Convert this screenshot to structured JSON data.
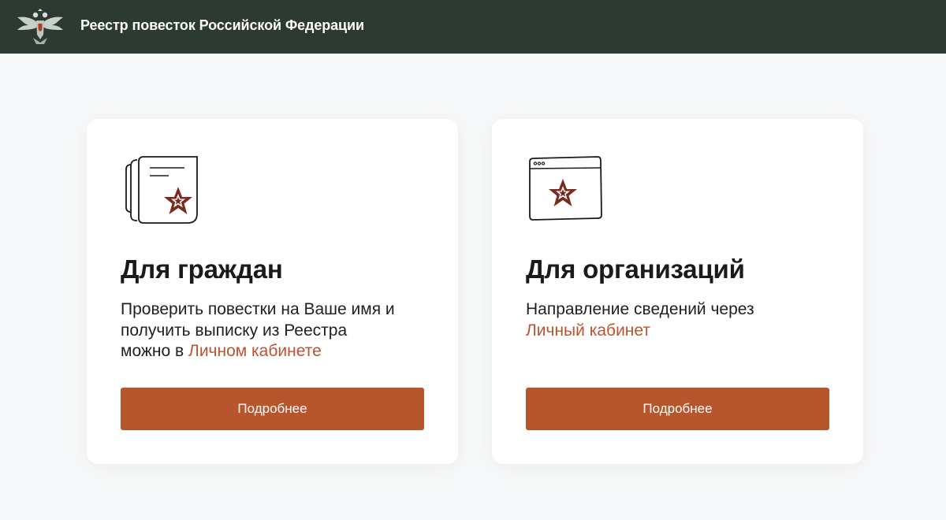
{
  "header": {
    "title": "Реестр повесток Российской Федерации",
    "emblem_icon": "double-headed-eagle-emblem"
  },
  "cards": [
    {
      "icon": "summons-document-star-icon",
      "title": "Для граждан",
      "desc_line1": "Проверить повестки на Ваше имя и",
      "desc_line2": "получить выписку из Реестра",
      "desc_line3_prefix": "можно в ",
      "desc_link": "Личном кабинете",
      "button_label": "Подробнее"
    },
    {
      "icon": "browser-window-star-icon",
      "title": "Для организаций",
      "desc_line1": "Направление сведений через",
      "desc_link": "Личный кабинет",
      "button_label": "Подробнее"
    }
  ],
  "colors": {
    "header_bg": "#2c3a31",
    "page_bg": "#f7f8f9",
    "accent": "#b7562d",
    "star": "#7a2b1f"
  }
}
